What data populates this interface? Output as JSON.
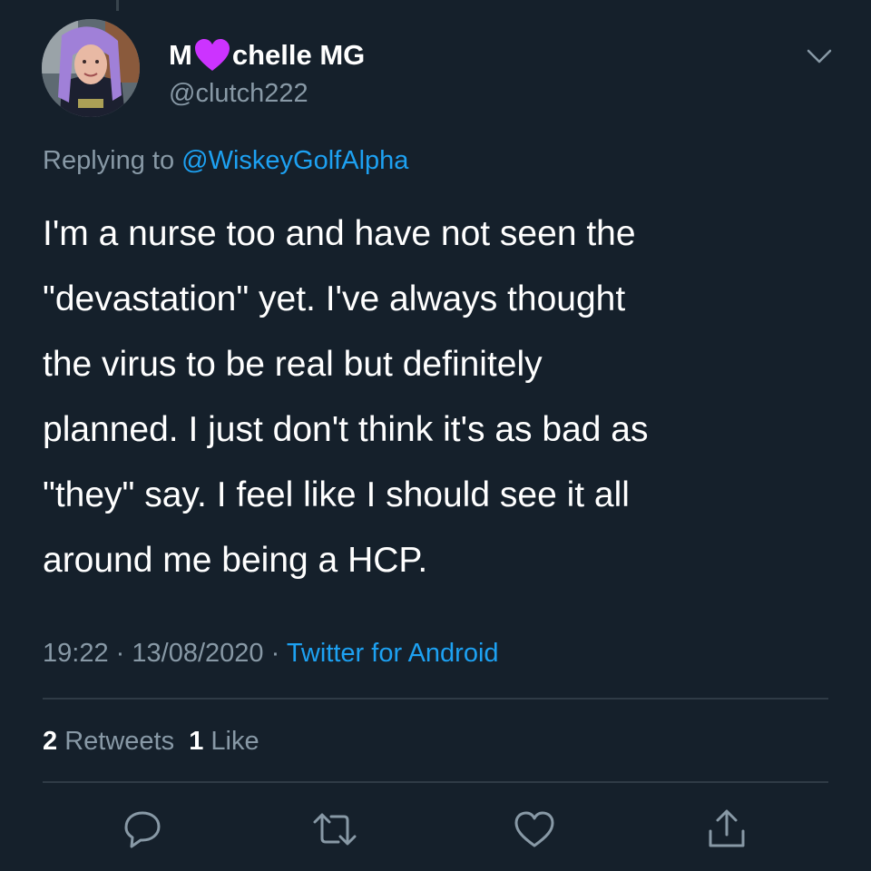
{
  "tweet": {
    "display_name_prefix": "M",
    "display_name_suffix": "chelle MG",
    "handle": "@clutch222",
    "reply_prefix": "Replying to",
    "reply_to": "@WiskeyGolfAlpha",
    "text": "I'm a nurse too and have not seen the\n\"devastation\" yet.  I've always thought\nthe virus to be real but definitely\nplanned. I just don't think it's as bad as\n\"they\" say. I feel like I should see it all\naround me being a HCP.",
    "time": "19:22",
    "separator": "·",
    "date": "13/08/2020",
    "source": "Twitter for Android",
    "retweets_count": "2",
    "retweets_label": "Retweets",
    "likes_count": "1",
    "likes_label": "Like"
  },
  "theme": {
    "background": "#15202b",
    "accent": "#1da1f2",
    "secondary_text": "#8899a6",
    "heart_emoji": "#cc33ff"
  },
  "icons": {
    "name_emoji": "purple-heart-icon",
    "menu": "chevron-down-icon",
    "actions": [
      "reply-icon",
      "retweet-icon",
      "like-icon",
      "share-icon"
    ]
  }
}
